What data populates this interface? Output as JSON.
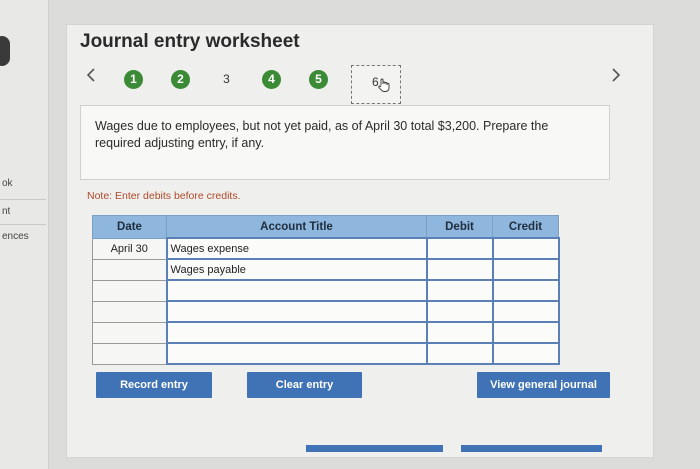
{
  "sidebar": {
    "labels": [
      "ok",
      "nt",
      "ences"
    ]
  },
  "header": {
    "title": "Journal entry worksheet"
  },
  "steps": {
    "items": [
      "1",
      "2",
      "3",
      "4",
      "5",
      "6"
    ],
    "current": "6"
  },
  "nav": {
    "prev_icon": "chevron-left-icon",
    "next_icon": "chevron-right-icon"
  },
  "question": {
    "text": "Wages due to employees, but not yet paid, as of April 30 total $3,200. Prepare the required adjusting entry, if any."
  },
  "note": "Note: Enter debits before credits.",
  "table": {
    "headers": [
      "Date",
      "Account Title",
      "Debit",
      "Credit"
    ],
    "rows": [
      [
        "April 30",
        "Wages expense",
        "",
        ""
      ],
      [
        "",
        "Wages payable",
        "",
        ""
      ],
      [
        "",
        "",
        "",
        ""
      ],
      [
        "",
        "",
        "",
        ""
      ],
      [
        "",
        "",
        "",
        ""
      ],
      [
        "",
        "",
        "",
        ""
      ]
    ]
  },
  "buttons": {
    "record": "Record entry",
    "clear": "Clear entry",
    "view": "View general journal"
  },
  "colors": {
    "accent": "#3f73b5",
    "step_complete": "#3b8a36",
    "header": "#8fb6dd"
  }
}
